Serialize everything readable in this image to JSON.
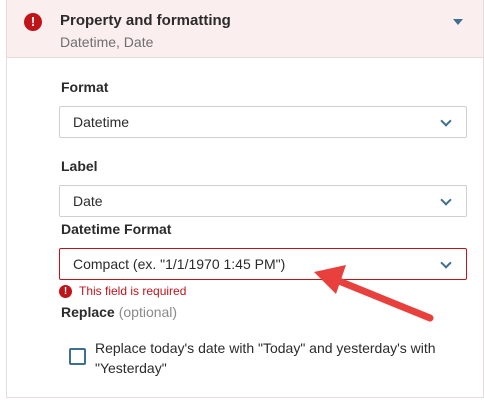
{
  "section": {
    "title": "Property and formatting",
    "subtitle": "Datetime, Date",
    "error_icon": "!"
  },
  "fields": {
    "format": {
      "label": "Format",
      "value": "Datetime"
    },
    "label": {
      "label": "Label",
      "value": "Date"
    },
    "datetime_format": {
      "label": "Datetime Format",
      "value": "Compact (ex. \"1/1/1970 1:45 PM\")",
      "error": "This field is required",
      "error_icon": "!"
    },
    "replace": {
      "label": "Replace",
      "optional": "(optional)",
      "checkbox_label": "Replace today's date with \"Today\" and yesterday's with \"Yesterday\"",
      "checked": false
    }
  },
  "colors": {
    "error": "#c0141b",
    "accent": "#3d6f91",
    "annotation_arrow": "#e8403c",
    "header_bg": "#fbeeee"
  }
}
